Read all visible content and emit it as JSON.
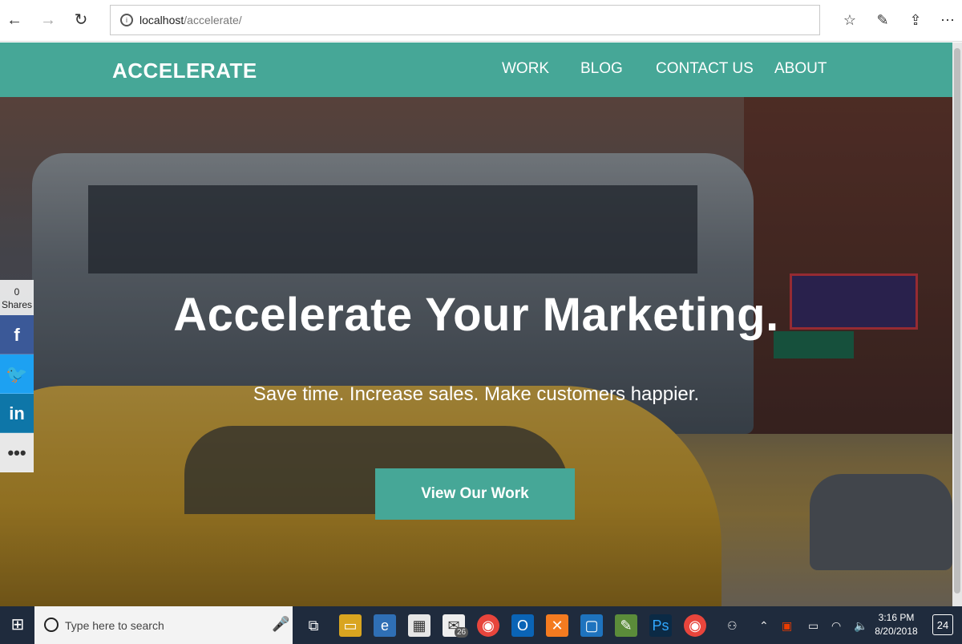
{
  "browser": {
    "back_icon": "←",
    "forward_icon": "→",
    "refresh_icon": "↻",
    "url_host": "localhost",
    "url_path": "/accelerate/",
    "favorite_icon": "☆",
    "notes_icon": "✎",
    "share_icon": "⇪"
  },
  "site": {
    "logo": "ACCELERATE",
    "nav": [
      "WORK",
      "BLOG",
      "CONTACT US",
      "ABOUT"
    ]
  },
  "hero": {
    "title": "Accelerate Your Marketing.",
    "subtitle": "Save time. Increase sales. Make customers happier.",
    "cta": "View Our Work"
  },
  "share": {
    "count": "0",
    "label": "Shares",
    "facebook": "f",
    "twitter": "🐦",
    "linkedin": "in",
    "more": "•••"
  },
  "taskbar": {
    "search_placeholder": "Type here to search",
    "mail_badge": "26",
    "time": "3:16 PM",
    "date": "8/20/2018",
    "notifications": "24"
  },
  "colors": {
    "brand": "#46a797",
    "facebook": "#3b5998",
    "twitter": "#1da1f2",
    "linkedin": "#0e76a8"
  }
}
